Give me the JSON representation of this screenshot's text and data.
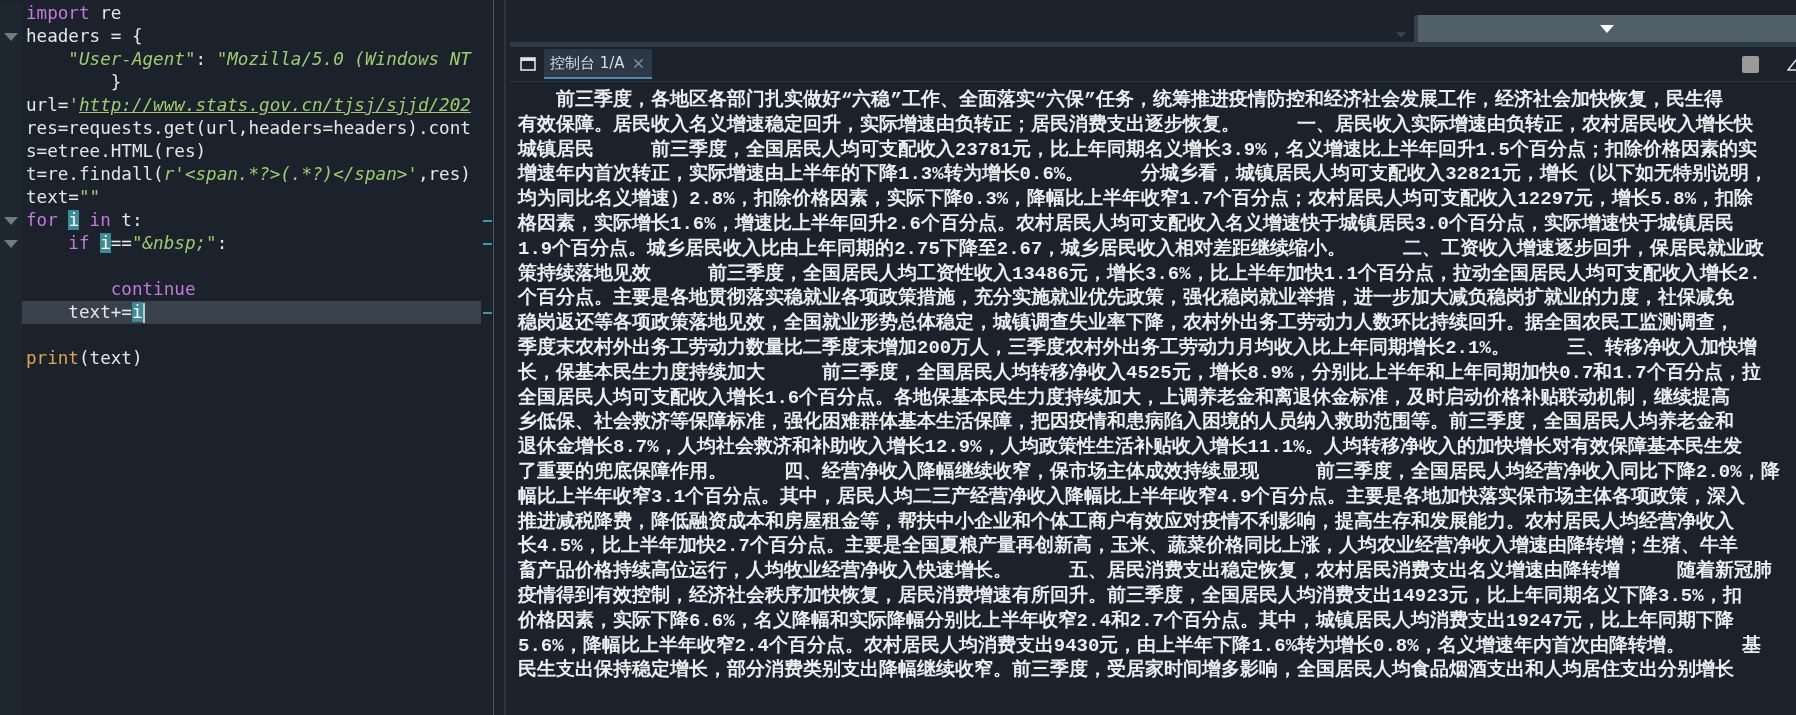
{
  "editor": {
    "lines": [
      {
        "tokens": [
          {
            "kind": "keyword",
            "text": "import"
          },
          {
            "kind": "plain",
            "text": " re"
          }
        ],
        "foldable": false,
        "current": false,
        "marker": false
      },
      {
        "tokens": [
          {
            "kind": "plain",
            "text": "headers = {"
          }
        ],
        "foldable": true,
        "current": false,
        "marker": false
      },
      {
        "tokens": [
          {
            "kind": "string",
            "text": "    \"User-Agent\""
          },
          {
            "kind": "plain",
            "text": ": "
          },
          {
            "kind": "string",
            "text": "\"Mozilla/5.0 (Windows NT"
          }
        ],
        "foldable": false,
        "current": false,
        "marker": false
      },
      {
        "tokens": [
          {
            "kind": "plain",
            "text": "        }"
          }
        ],
        "foldable": false,
        "current": false,
        "marker": false
      },
      {
        "tokens": [
          {
            "kind": "plain",
            "text": "url="
          },
          {
            "kind": "string",
            "text": "'"
          },
          {
            "kind": "link",
            "text": "http://www.stats.gov.cn/tjsj/sjjd/202"
          }
        ],
        "foldable": false,
        "current": false,
        "marker": false
      },
      {
        "tokens": [
          {
            "kind": "plain",
            "text": "res=requests.get(url,headers=headers).cont"
          }
        ],
        "foldable": false,
        "current": false,
        "marker": false
      },
      {
        "tokens": [
          {
            "kind": "plain",
            "text": "s=etree.HTML(res)"
          }
        ],
        "foldable": false,
        "current": false,
        "marker": false
      },
      {
        "tokens": [
          {
            "kind": "plain",
            "text": "t=re.findall("
          },
          {
            "kind": "string",
            "text": "r'<span.*?>(.*?)</span>'"
          },
          {
            "kind": "plain",
            "text": ",res)"
          }
        ],
        "foldable": false,
        "current": false,
        "marker": false
      },
      {
        "tokens": [
          {
            "kind": "plain",
            "text": "text="
          },
          {
            "kind": "string",
            "text": "\"\""
          }
        ],
        "foldable": false,
        "current": false,
        "marker": false
      },
      {
        "tokens": [
          {
            "kind": "keyword",
            "text": "for "
          },
          {
            "kind": "match",
            "text": "i"
          },
          {
            "kind": "keyword",
            "text": " in"
          },
          {
            "kind": "plain",
            "text": " t:"
          }
        ],
        "foldable": true,
        "current": false,
        "marker": true
      },
      {
        "tokens": [
          {
            "kind": "keyword",
            "text": "    if "
          },
          {
            "kind": "match",
            "text": "i"
          },
          {
            "kind": "plain",
            "text": "=="
          },
          {
            "kind": "string",
            "text": "\"&nbsp;\""
          },
          {
            "kind": "plain",
            "text": ":"
          }
        ],
        "foldable": true,
        "current": false,
        "marker": true
      },
      {
        "foldable": false,
        "current": false,
        "marker": false
      },
      {
        "tokens": [
          {
            "kind": "keyword",
            "text": "        continue"
          }
        ],
        "foldable": false,
        "current": false,
        "marker": false
      },
      {
        "tokens": [
          {
            "kind": "plain",
            "text": "    text+="
          },
          {
            "kind": "match",
            "text": "i"
          }
        ],
        "foldable": false,
        "current": true,
        "marker": true
      },
      {
        "foldable": false,
        "current": false,
        "marker": false
      },
      {
        "tokens": [
          {
            "kind": "builtin",
            "text": "print"
          },
          {
            "kind": "plain",
            "text": "(text)"
          }
        ],
        "foldable": false,
        "current": false,
        "marker": false
      }
    ]
  },
  "console": {
    "tabs": [
      {
        "label": "控制台 1/A",
        "selected": true
      }
    ],
    "lines": [
      "　　前三季度，各地区各部门扎实做好“六稳”工作、全面落实“六保”任务，统筹推进疫情防控和经济社会发展工作，经济社会加快恢复，民生得",
      "有效保障。居民收入名义增速稳定回升，实际增速由负转正；居民消费支出逐步恢复。　　　一、居民收入实际增速由负转正，农村居民收入增长快",
      "城镇居民　　　前三季度，全国居民人均可支配收入23781元，比上年同期名义增长3.9%，名义增速比上半年回升1.5个百分点；扣除价格因素的实",
      "增速年内首次转正，实际增速由上半年的下降1.3%转为增长0.6%。　　　分城乡看，城镇居民人均可支配收入32821元，增长（以下如无特别说明，",
      "均为同比名义增速）2.8%，扣除价格因素，实际下降0.3%，降幅比上半年收窄1.7个百分点；农村居民人均可支配收入12297元，增长5.8%，扣除",
      "格因素，实际增长1.6%，增速比上半年回升2.6个百分点。农村居民人均可支配收入名义增速快于城镇居民3.0个百分点，实际增速快于城镇居民",
      "1.9个百分点。城乡居民收入比由上年同期的2.75下降至2.67，城乡居民收入相对差距继续缩小。　　　二、工资收入增速逐步回升，保居民就业政",
      "策持续落地见效　　　前三季度，全国居民人均工资性收入13486元，增长3.6%，比上半年加快1.1个百分点，拉动全国居民人均可支配收入增长2.",
      "个百分点。主要是各地贯彻落实稳就业各项政策措施，充分实施就业优先政策，强化稳岗就业举措，进一步加大减负稳岗扩就业的力度，社保减免",
      "稳岗返还等各项政策落地见效，全国就业形势总体稳定，城镇调查失业率下降，农村外出务工劳动力人数环比持续回升。据全国农民工监测调查，",
      "季度末农村外出务工劳动力数量比二季度末增加200万人，三季度农村外出务工劳动力月均收入比上年同期增长2.1%。　　　三、转移净收入加快增",
      "长，保基本民生力度持续加大　　　前三季度，全国居民人均转移净收入4525元，增长8.9%，分别比上半年和上年同期加快0.7和1.7个百分点，拉",
      "全国居民人均可支配收入增长1.6个百分点。各地保基本民生力度持续加大，上调养老金和离退休金标准，及时启动价格补贴联动机制，继续提高",
      "乡低保、社会救济等保障标准，强化困难群体基本生活保障，把因疫情和患病陷入困境的人员纳入救助范围等。前三季度，全国居民人均养老金和",
      "退休金增长8.7%，人均社会救济和补助收入增长12.9%，人均政策性生活补贴收入增长11.1%。人均转移净收入的加快增长对有效保障基本民生发",
      "了重要的兜底保障作用。　　　四、经营净收入降幅继续收窄，保市场主体成效持续显现　　　前三季度，全国居民人均经营净收入同比下降2.0%，降",
      "幅比上半年收窄3.1个百分点。其中，居民人均二三产经营净收入降幅比上半年收窄4.9个百分点。主要是各地加快落实保市场主体各项政策，深入",
      "推进减税降费，降低融资成本和房屋租金等，帮扶中小企业和个体工商户有效应对疫情不利影响，提高生存和发展能力。农村居民人均经营净收入",
      "长4.5%，比上半年加快2.7个百分点。主要是全国夏粮产量再创新高，玉米、蔬菜价格同比上涨，人均农业经营净收入增速由降转增；生猪、牛羊",
      "畜产品价格持续高位运行，人均牧业经营净收入快速增长。　　　五、居民消费支出稳定恢复，农村居民消费支出名义增速由降转增　　　随着新冠肺",
      "疫情得到有效控制，经济社会秩序加快恢复，居民消费增速有所回升。前三季度，全国居民人均消费支出14923元，比上年同期名义下降3.5%，扣",
      "价格因素，实际下降6.6%，名义降幅和实际降幅分别比上半年收窄2.4和2.7个百分点。其中，城镇居民人均消费支出19247元，比上年同期下降",
      "5.6%，降幅比上半年收窄2.4个百分点。农村居民人均消费支出9430元，由上半年下降1.6%转为增长0.8%，名义增速年内首次由降转增。　　　基",
      "民生支出保持稳定增长，部分消费类别支出降幅继续收窄。前三季度，受居家时间增多影响，全国居民人均食品烟酒支出和人均居住支出分别增长"
    ]
  }
}
